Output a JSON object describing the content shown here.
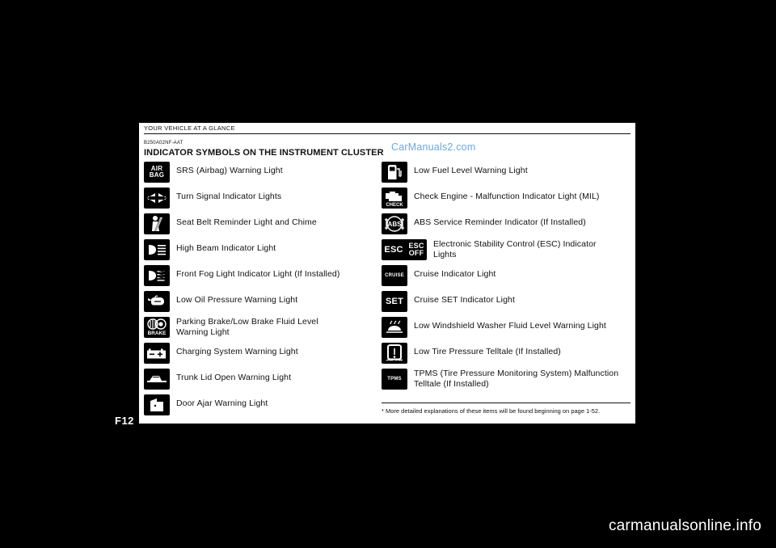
{
  "header": {
    "section": "YOUR VEHICLE AT A GLANCE",
    "doc_code": "B250A02NF-AAT",
    "title": "INDICATOR SYMBOLS ON THE INSTRUMENT CLUSTER",
    "watermark": "CarManuals2.com"
  },
  "left_column": [
    {
      "icon": "airbag-icon",
      "icon_text": "AIR\nBAG",
      "label": "SRS (Airbag) Warning Light"
    },
    {
      "icon": "turn-signal-icon",
      "icon_text": "",
      "label": "Turn Signal Indicator Lights"
    },
    {
      "icon": "seat-belt-icon",
      "icon_text": "",
      "label": "Seat Belt Reminder Light and Chime"
    },
    {
      "icon": "high-beam-icon",
      "icon_text": "",
      "label": "High Beam Indicator Light"
    },
    {
      "icon": "front-fog-light-icon",
      "icon_text": "",
      "label": "Front Fog Light Indicator Light (If Installed)"
    },
    {
      "icon": "oil-pressure-icon",
      "icon_text": "",
      "label": "Low Oil Pressure Warning Light"
    },
    {
      "icon": "parking-brake-icon",
      "icon_text": "BRAKE",
      "label": "Parking Brake/Low Brake Fluid Level\nWarning Light"
    },
    {
      "icon": "battery-icon",
      "icon_text": "",
      "label": "Charging System Warning Light"
    },
    {
      "icon": "trunk-lid-icon",
      "icon_text": "",
      "label": "Trunk Lid Open Warning Light"
    },
    {
      "icon": "door-ajar-icon",
      "icon_text": "",
      "label": "Door Ajar Warning Light"
    }
  ],
  "right_column": [
    {
      "icon": "fuel-pump-icon",
      "icon_text": "",
      "label": "Low Fuel Level Warning Light"
    },
    {
      "icon": "check-engine-icon",
      "icon_text": "CHECK",
      "label": "Check Engine - Malfunction Indicator Light (MIL)"
    },
    {
      "icon": "abs-icon",
      "icon_text": "ABS",
      "label": "ABS Service Reminder Indicator (If Installed)"
    },
    {
      "icon": "esc-icon",
      "icon_text": "ESC",
      "icon_text2": "ESC\nOFF",
      "label": "Electronic Stability Control (ESC) Indicator\nLights"
    },
    {
      "icon": "cruise-icon",
      "icon_text": "CRUISE",
      "label": "Cruise Indicator Light"
    },
    {
      "icon": "cruise-set-icon",
      "icon_text": "SET",
      "label": "Cruise SET Indicator Light"
    },
    {
      "icon": "washer-fluid-icon",
      "icon_text": "",
      "label": "Low Windshield Washer Fluid Level Warning Light"
    },
    {
      "icon": "tire-pressure-icon",
      "icon_text": "",
      "label": "Low Tire Pressure Telltale (If Installed)"
    },
    {
      "icon": "tpms-icon",
      "icon_text": "TPMS",
      "label": "TPMS (Tire Pressure Monitoring System) Malfunction\nTelltale (If Installed)"
    }
  ],
  "footnote": "* More detailed explanations of these items will be found beginning on page 1-52.",
  "page_number": "F12",
  "site_brand": "carmanualsonline.info"
}
